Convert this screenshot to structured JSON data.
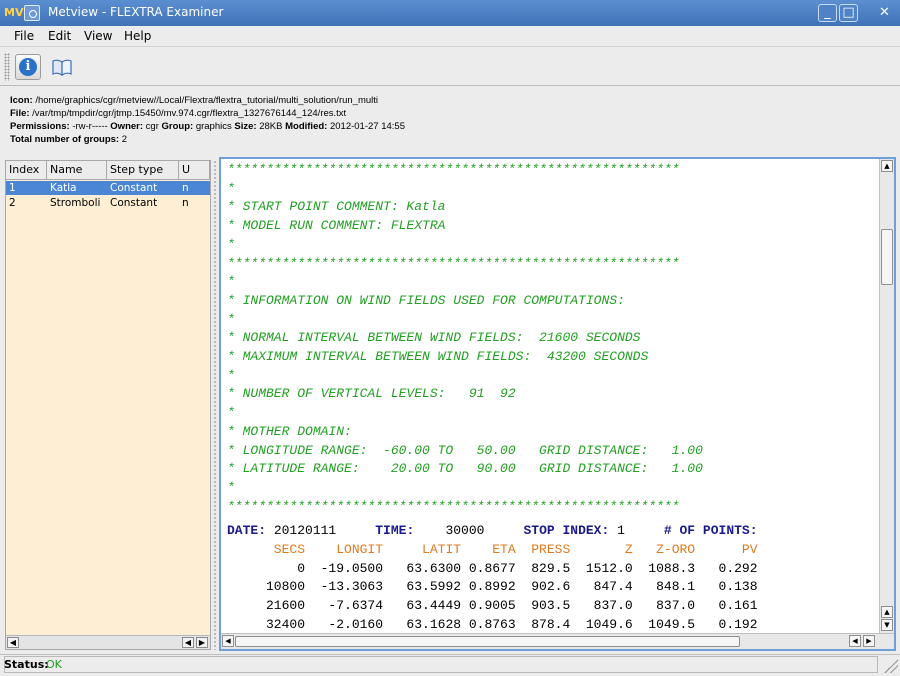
{
  "window": {
    "app_logo": "MV",
    "title": "Metview - FLEXTRA Examiner",
    "buttons": {
      "minimize": "_",
      "maximize": "□",
      "close": "✕"
    }
  },
  "menu": {
    "file": "File",
    "edit": "Edit",
    "view": "View",
    "help": "Help"
  },
  "toolbar": {
    "info_icon": "info-icon",
    "book_icon": "book-icon",
    "info_glyph": "i"
  },
  "info": {
    "icon_label": "Icon:",
    "icon_value": "/home/graphics/cgr/metview//Local/Flextra/flextra_tutorial/multi_solution/run_multi",
    "file_label": "File:",
    "file_value": "/var/tmp/tmpdir/cgr/jtmp.15450/mv.974.cgr/flextra_1327676144_124/res.txt",
    "permissions_label": "Permissions:",
    "permissions_value": "-rw-r-----",
    "owner_label": "Owner:",
    "owner_value": "cgr",
    "group_label": "Group:",
    "group_value": "graphics",
    "size_label": "Size:",
    "size_value": "28KB",
    "modified_label": "Modified:",
    "modified_value": "2012-01-27 14:55",
    "total_label": "Total number of groups:",
    "total_value": "2"
  },
  "groups_table": {
    "columns": {
      "index": "Index",
      "name": "Name",
      "step_type": "Step type",
      "u": "U"
    },
    "rows": [
      {
        "index": "1",
        "name": "Katla",
        "step_type": "Constant",
        "u": "n"
      },
      {
        "index": "2",
        "name": "Stromboli",
        "step_type": "Constant",
        "u": "n"
      }
    ]
  },
  "file_text": {
    "header_lines": [
      "**********************************************************",
      "*",
      "* START POINT COMMENT: Katla",
      "* MODEL RUN COMMENT: FLEXTRA",
      "*",
      "**********************************************************",
      "*",
      "* INFORMATION ON WIND FIELDS USED FOR COMPUTATIONS:",
      "*",
      "* NORMAL INTERVAL BETWEEN WIND FIELDS:  21600 SECONDS",
      "* MAXIMUM INTERVAL BETWEEN WIND FIELDS:  43200 SECONDS",
      "*",
      "* NUMBER OF VERTICAL LEVELS:   91  92",
      "*",
      "* MOTHER DOMAIN:",
      "* LONGITUDE RANGE:  -60.00 TO   50.00   GRID DISTANCE:   1.00",
      "* LATITUDE RANGE:    20.00 TO   90.00   GRID DISTANCE:   1.00",
      "*",
      "**********************************************************"
    ],
    "summary": {
      "date_label": "DATE:",
      "date_value": "20120111",
      "time_label": "TIME:",
      "time_value": "30000",
      "stop_label": "STOP INDEX:",
      "stop_value": "1",
      "points_label": "# OF POINTS:"
    },
    "columns": [
      "SECS",
      "LONGIT",
      "LATIT",
      "ETA",
      "PRESS",
      "Z",
      "Z-ORO",
      "PV"
    ],
    "rows": [
      [
        "0",
        "-19.0500",
        "63.6300",
        "0.8677",
        "829.5",
        "1512.0",
        "1088.3",
        "0.292"
      ],
      [
        "10800",
        "-13.3063",
        "63.5992",
        "0.8992",
        "902.6",
        "847.4",
        "848.1",
        "0.138"
      ],
      [
        "21600",
        "-7.6374",
        "63.4449",
        "0.9005",
        "903.5",
        "837.0",
        "837.0",
        "0.161"
      ],
      [
        "32400",
        "-2.0160",
        "63.1628",
        "0.8763",
        "878.4",
        "1049.6",
        "1049.5",
        "0.192"
      ]
    ]
  },
  "status": {
    "label": "Status:",
    "value": "OK"
  }
}
